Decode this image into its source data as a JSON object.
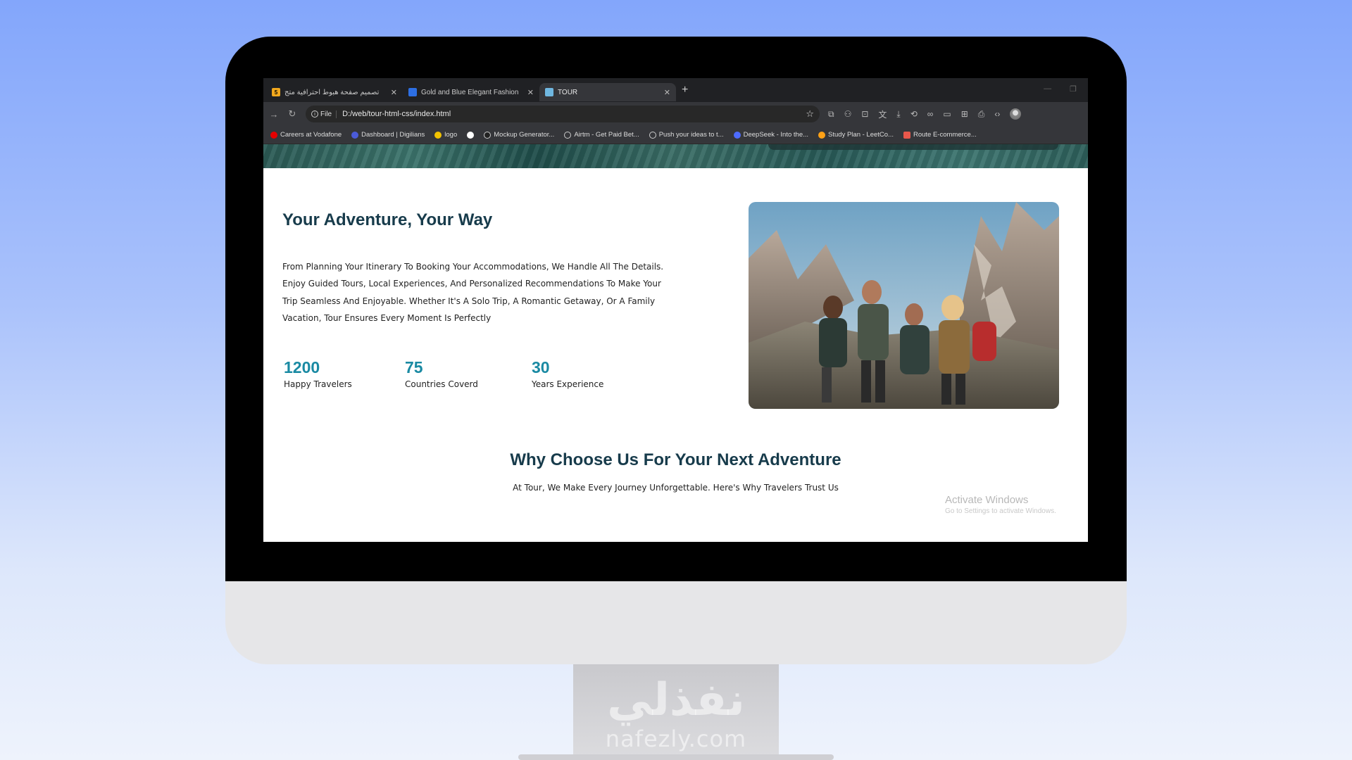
{
  "browser": {
    "tabs": [
      {
        "title": "تصميم صفحة هبوط احترافية متج",
        "favicon_letter": "5",
        "favicon_color": "#f2a81d",
        "active": false
      },
      {
        "title": "Gold and Blue Elegant Fashion",
        "favicon_letter": "",
        "favicon_color": "#2d6fe3",
        "active": false
      },
      {
        "title": "TOUR",
        "favicon_letter": "",
        "favicon_color": "#6fb7e0",
        "active": true
      }
    ],
    "new_tab_icon": "+",
    "address": {
      "chip": "File",
      "url": "D:/web/tour-html-css/index.html"
    },
    "bookmarks": [
      {
        "label": "Careers at Vodafone",
        "color": "#e60000"
      },
      {
        "label": "Dashboard | Digilians",
        "color": "#4b5bd8"
      },
      {
        "label": "logo",
        "color": "#f2c200"
      },
      {
        "label": "",
        "color": "#ffffff"
      },
      {
        "label": "Mockup Generator...",
        "color": "#222222"
      },
      {
        "label": "Airtm - Get Paid Bet...",
        "color": "#cccccc"
      },
      {
        "label": "Push your ideas to t...",
        "color": "#cccccc"
      },
      {
        "label": "DeepSeek - Into the...",
        "color": "#4d6bfe"
      },
      {
        "label": "Study Plan - LeetCo...",
        "color": "#ffa116"
      },
      {
        "label": "Route E-commerce...",
        "color": "#e8574b"
      }
    ]
  },
  "about": {
    "heading": "Your Adventure, Your Way",
    "body": "From Planning Your Itinerary To Booking Your Accommodations, We Handle All The Details. Enjoy Guided Tours, Local Experiences, And Personalized Recommendations To Make Your Trip Seamless And Enjoyable. Whether It's A Solo Trip, A Romantic Getaway, Or A Family Vacation, Tour Ensures Every Moment Is Perfectly",
    "stats": [
      {
        "value": "1200",
        "label": "Happy Travelers"
      },
      {
        "value": "75",
        "label": "Countries Coverd"
      },
      {
        "value": "30",
        "label": "Years Experience"
      }
    ]
  },
  "why": {
    "heading": "Why Choose Us For Your Next Adventure",
    "subheading": "At Tour, We Make Every Journey Unforgettable. Here's Why Travelers Trust Us"
  },
  "os_notice": {
    "title": "Activate Windows",
    "subtitle": "Go to Settings to activate Windows."
  },
  "watermark": {
    "arabic": "نفذلي",
    "latin": "nafezly.com"
  },
  "colors": {
    "accent": "#1a8aa3",
    "heading": "#173b4b"
  }
}
